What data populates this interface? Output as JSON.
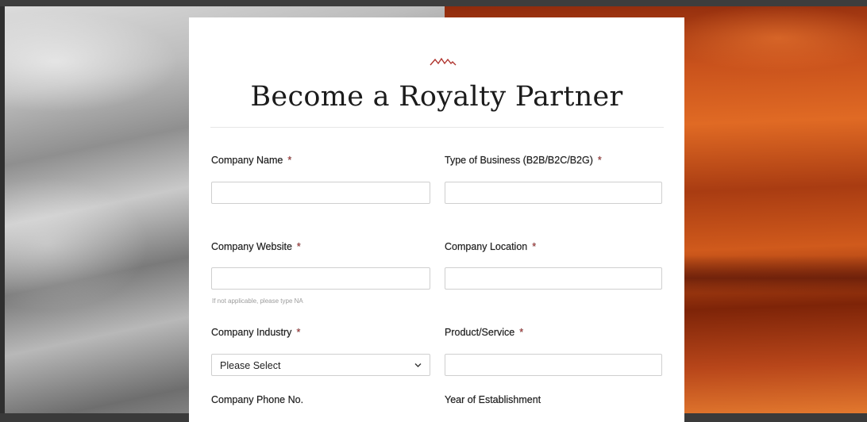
{
  "page": {
    "title": "Become a Royalty Partner"
  },
  "form": {
    "required_marker": "*",
    "fields": {
      "company_name": {
        "label": "Company Name",
        "value": ""
      },
      "business_type": {
        "label": "Type of Business (B2B/B2C/B2G)",
        "value": ""
      },
      "company_website": {
        "label": "Company Website",
        "value": "",
        "hint": "If not applicable, please type NA"
      },
      "company_location": {
        "label": "Company Location",
        "value": ""
      },
      "company_industry": {
        "label": "Company Industry",
        "selected": "Please Select"
      },
      "product_service": {
        "label": "Product/Service",
        "value": ""
      },
      "company_phone": {
        "label": "Company Phone No."
      },
      "year_established": {
        "label": "Year of Establishment"
      }
    }
  },
  "icons": {
    "logo": "mountain-logo-icon",
    "dropdown": "chevron-down-icon"
  },
  "colors": {
    "accent": "#b0342e",
    "required": "#d23f3f",
    "border": "#cfcfcf"
  }
}
